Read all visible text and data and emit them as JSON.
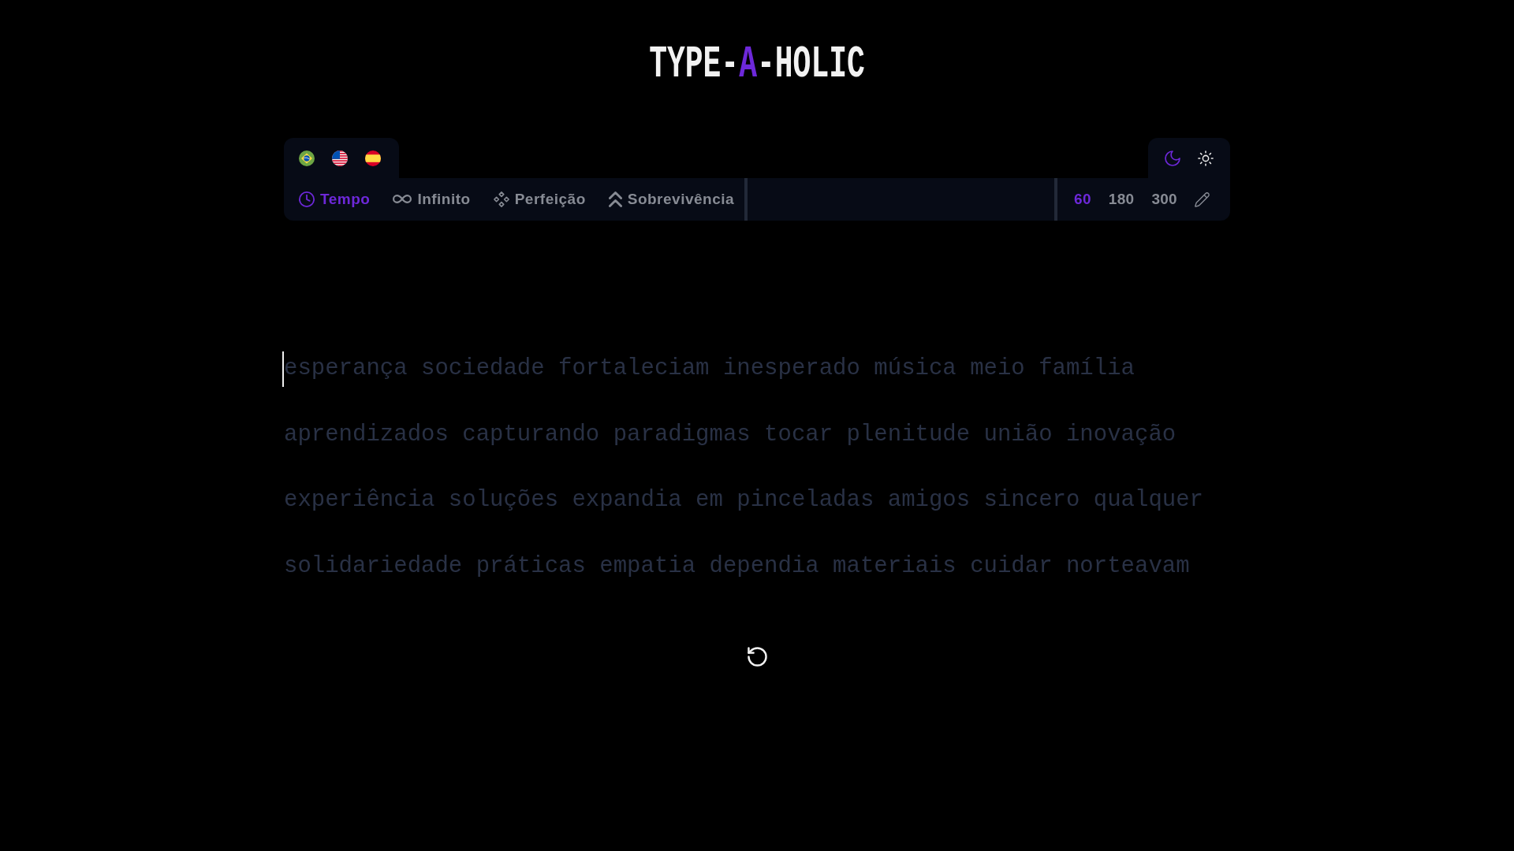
{
  "logo": {
    "parts": [
      {
        "text": "TYPE-",
        "accent": false
      },
      {
        "text": "A",
        "accent": true
      },
      {
        "text": "-HOLIC",
        "accent": false
      }
    ]
  },
  "themes": [
    {
      "selected": true
    },
    {
      "selected": false
    }
  ],
  "modes": [
    {
      "label": "Tempo",
      "selected": true
    },
    {
      "label": "Infinito",
      "selected": false
    },
    {
      "label": "Perfeição",
      "selected": false
    },
    {
      "label": "Sobrevivência",
      "selected": false
    }
  ],
  "durations": [
    {
      "label": "60",
      "selected": true
    },
    {
      "label": "180",
      "selected": false
    },
    {
      "label": "300",
      "selected": false
    }
  ],
  "typing": {
    "caret": true,
    "lines": [
      "esperança sociedade fortaleciam inesperado música meio família",
      "aprendizados capturando paradigmas tocar plenitude união inovação",
      "experiência soluções expandia em pinceladas amigos sincero qualquer",
      "solidariedade práticas empatia dependia materiais cuidar norteavam"
    ]
  }
}
